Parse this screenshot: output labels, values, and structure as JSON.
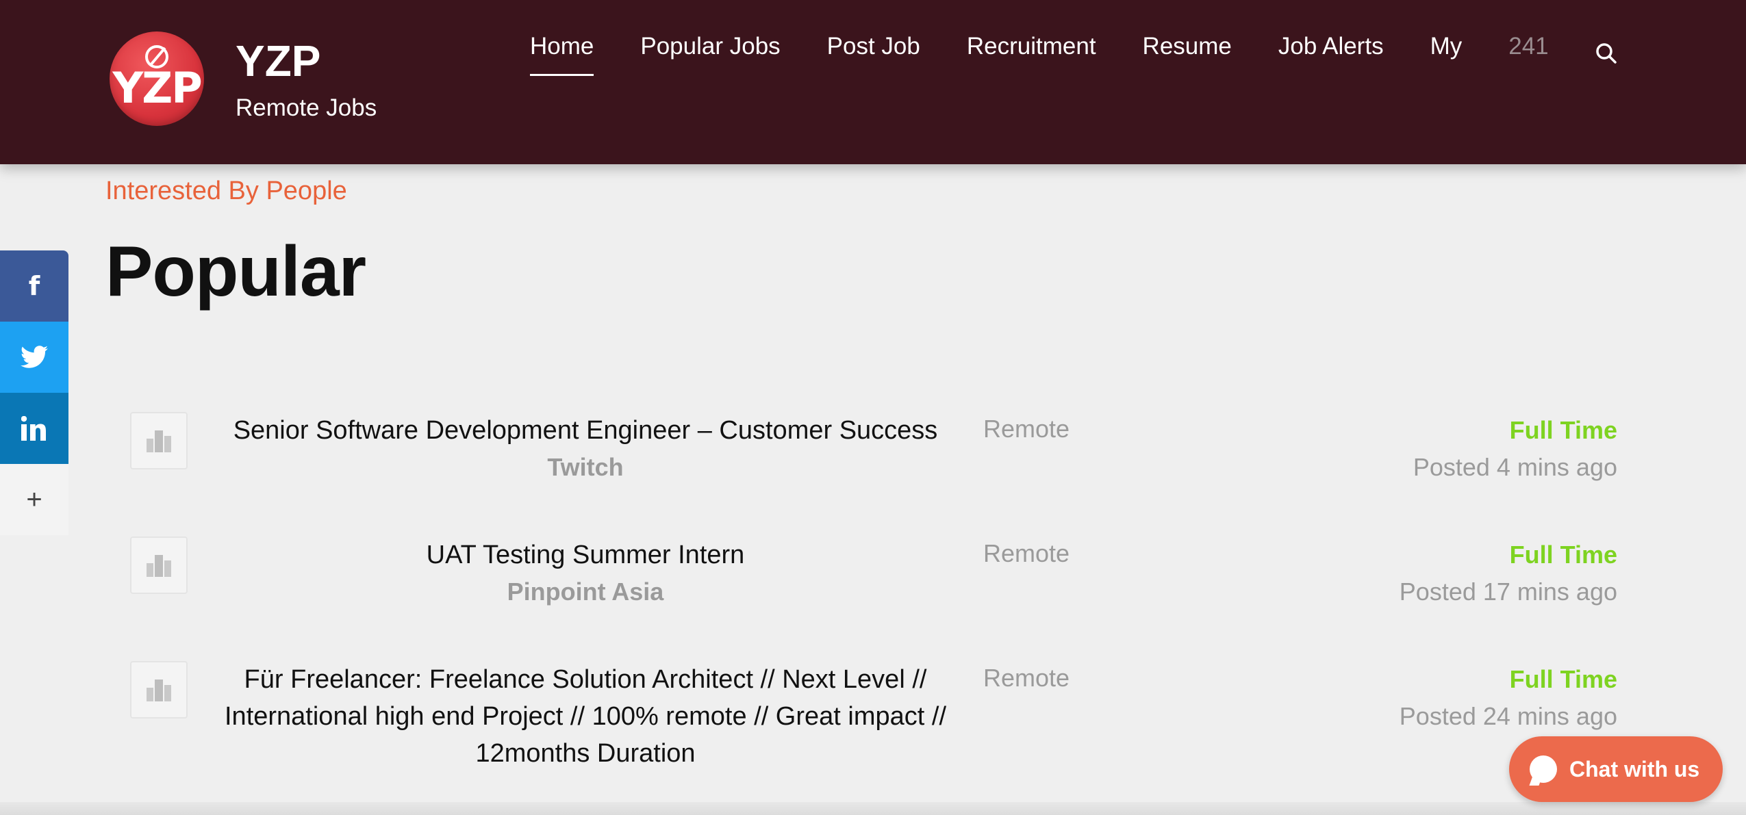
{
  "header": {
    "logo_text": "YZP",
    "brand_title": "YZP",
    "brand_subtitle": "Remote Jobs",
    "nav": [
      {
        "label": "Home",
        "active": true
      },
      {
        "label": "Popular Jobs"
      },
      {
        "label": "Post Job"
      },
      {
        "label": "Recruitment"
      },
      {
        "label": "Resume"
      },
      {
        "label": "Job Alerts"
      },
      {
        "label": "My"
      }
    ],
    "count": "241"
  },
  "share": {
    "facebook": "f",
    "more": "+"
  },
  "main": {
    "eyebrow": "Interested By People",
    "title": "Popular"
  },
  "jobs": [
    {
      "title": "Senior Software Development Engineer – Customer Success",
      "company": "Twitch",
      "location": "Remote",
      "type": "Full Time",
      "posted": "Posted 4 mins ago"
    },
    {
      "title": "UAT Testing Summer Intern",
      "company": "Pinpoint Asia",
      "location": "Remote",
      "type": "Full Time",
      "posted": "Posted 17 mins ago"
    },
    {
      "title_lines": [
        "Für Freelancer: Freelance Solution Architect // Next Level //",
        "International high end Project // 100% remote // Great impact //",
        "12months Duration"
      ],
      "location": "Remote",
      "type": "Full Time",
      "posted": "Posted 24 mins ago"
    }
  ],
  "chat": {
    "label": "Chat with us"
  },
  "colors": {
    "header_bg": "#3b141c",
    "accent": "#e8623a",
    "job_type": "#7ed321",
    "chat": "#ec6a4c"
  }
}
